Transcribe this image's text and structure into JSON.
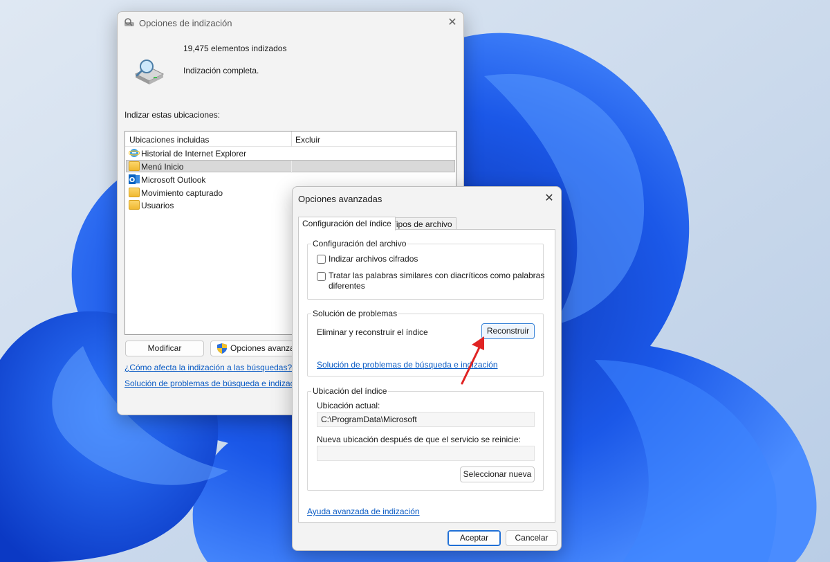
{
  "main_dialog": {
    "title": "Opciones de indización",
    "items_indexed": "19,475 elementos indizados",
    "status": "Indización completa.",
    "section_label": "Indizar estas ubicaciones:",
    "columns": {
      "included": "Ubicaciones incluidas",
      "exclude": "Excluir"
    },
    "locations": [
      {
        "name": "Historial de Internet Explorer",
        "icon": "internet-explorer-icon"
      },
      {
        "name": "Menú Inicio",
        "icon": "folder-icon",
        "selected": true
      },
      {
        "name": "Microsoft Outlook",
        "icon": "outlook-icon"
      },
      {
        "name": "Movimiento capturado",
        "icon": "folder-icon"
      },
      {
        "name": "Usuarios",
        "icon": "folder-icon"
      }
    ],
    "modify_button": "Modificar",
    "advanced_button": "Opciones avanzadas",
    "link_how": "¿Cómo afecta la indización a las búsquedas?",
    "link_troubleshoot": "Solución de problemas de búsqueda e indización"
  },
  "advanced_dialog": {
    "title": "Opciones avanzadas",
    "tabs": [
      "Configuración del índice",
      "Tipos de archivo"
    ],
    "file_settings": {
      "title": "Configuración del archivo",
      "option_encrypted": "Indizar archivos cifrados",
      "option_diacritics_line1": "Tratar las palabras similares con diacríticos como palabras",
      "option_diacritics_line2": "diferentes"
    },
    "troubleshooting": {
      "title": "Solución de problemas",
      "rebuild_label": "Eliminar y reconstruir el índice",
      "rebuild_button": "Reconstruir",
      "link": "Solución de problemas de búsqueda e indización"
    },
    "index_location": {
      "title": "Ubicación del índice",
      "current_label": "Ubicación actual:",
      "current_value": "C:\\ProgramData\\Microsoft",
      "new_label": "Nueva ubicación después de que el servicio se reinicie:",
      "new_value": "",
      "select_button": "Seleccionar nueva"
    },
    "help_link": "Ayuda avanzada de indización",
    "ok_button": "Aceptar",
    "cancel_button": "Cancelar"
  },
  "colors": {
    "accent": "#1f6fd6",
    "link": "#0a5bc4",
    "annotation_arrow": "#e02424"
  }
}
